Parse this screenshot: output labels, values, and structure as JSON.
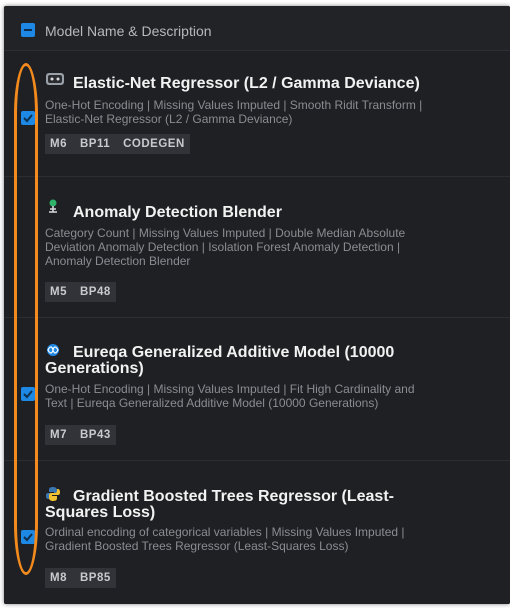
{
  "header": {
    "title": "Model Name & Description"
  },
  "models": [
    {
      "name": "Elastic-Net Regressor (L2 / Gamma Deviance)",
      "description": "One-Hot Encoding | Missing Values Imputed | Smooth Ridit Transform | Elastic-Net Regressor (L2 / Gamma Deviance)",
      "tags": [
        "M6",
        "BP11",
        "CODEGEN"
      ],
      "checked": true,
      "icon": "robot-icon"
    },
    {
      "name": "Anomaly Detection Blender",
      "description": "Category Count | Missing Values Imputed | Double Median Absolute Deviation Anomaly Detection | Isolation Forest Anomaly Detection | Anomaly Detection Blender",
      "tags": [
        "M5",
        "BP48"
      ],
      "checked": false,
      "icon": "blender-icon"
    },
    {
      "name": "Eureqa Generalized Additive Model (10000 Generations)",
      "description": "One-Hot Encoding | Missing Values Imputed | Fit High Cardinality and Text | Eureqa Generalized Additive Model (10000 Generations)",
      "tags": [
        "M7",
        "BP43"
      ],
      "checked": true,
      "icon": "eureqa-icon"
    },
    {
      "name": "Gradient Boosted Trees Regressor (Least-Squares Loss)",
      "description": "Ordinal encoding of categorical variables | Missing Values Imputed | Gradient Boosted Trees Regressor (Least-Squares Loss)",
      "tags": [
        "M8",
        "BP85"
      ],
      "checked": true,
      "icon": "python-icon"
    }
  ],
  "colors": {
    "accent": "#1e88e5",
    "highlight": "#f28a1d",
    "background": "#1b1c1f"
  }
}
